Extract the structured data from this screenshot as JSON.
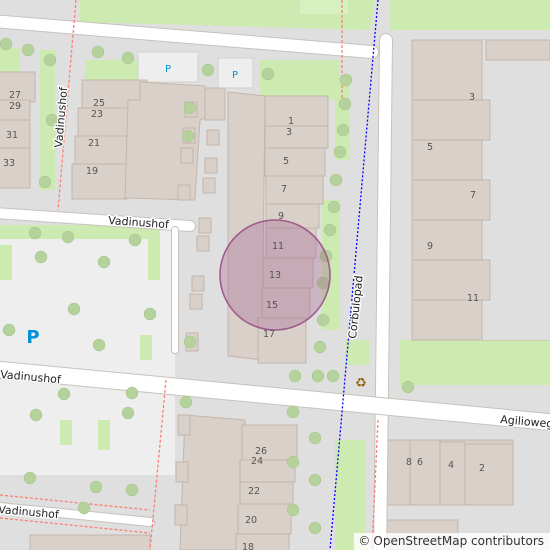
{
  "map": {
    "streets": {
      "vadinushof_top": "Vadinushof",
      "vadinushof_vertical": "Vadinushof",
      "vadinushof_main": "Vadinushof",
      "vadinushof_bottom": "Vadinushof",
      "corbulopad": "Corbulopad",
      "agilioweg": "Agilioweg"
    },
    "parking_labels": [
      "P",
      "P",
      "P"
    ],
    "house_numbers": {
      "left_col": [
        "27",
        "29",
        "31",
        "33"
      ],
      "mid_col": [
        "25",
        "23",
        "21",
        "19"
      ],
      "center_col": [
        "1",
        "3",
        "5",
        "7",
        "9",
        "11",
        "13",
        "15",
        "17"
      ],
      "right_col": [
        "3",
        "5",
        "7",
        "9",
        "11"
      ],
      "bottom_mid": [
        "26",
        "24",
        "22",
        "20",
        "18"
      ],
      "bottom_right": [
        "8",
        "6",
        "4",
        "2"
      ]
    },
    "colors": {
      "background": "#f2efe9",
      "residential": "#e0dfdf",
      "building": "#d9d0c9",
      "building_stroke": "#c4b6ab",
      "grass": "#cdebb0",
      "road": "#ffffff",
      "tree": "#b5d29c",
      "footway": "#fa8072",
      "cycleway": "#0000ff",
      "highlight": "#a05a8c"
    },
    "icons": {
      "recycling": "recycling-icon",
      "parking": "parking-icon"
    }
  },
  "attribution": {
    "symbol": "©",
    "text": "OpenStreetMap contributors"
  }
}
